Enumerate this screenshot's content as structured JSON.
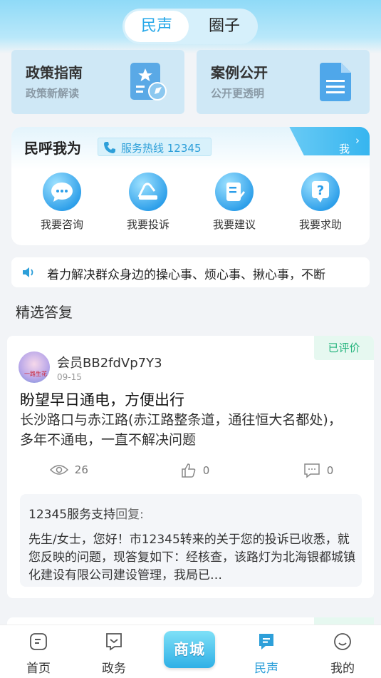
{
  "header": {
    "tabs": [
      {
        "label": "民声",
        "active": true
      },
      {
        "label": "圈子",
        "active": false
      }
    ]
  },
  "policy_cards": [
    {
      "title": "政策指南",
      "subtitle": "政策新解读",
      "icon": "policy-doc-icon"
    },
    {
      "title": "案例公开",
      "subtitle": "公开更透明",
      "icon": "document-icon"
    }
  ],
  "voice_panel": {
    "title": "民呼我为",
    "hotline": "服务热线 12345",
    "my_submissions": "我提交的",
    "actions": [
      {
        "label": "我要咨询",
        "icon": "chat-bubble-icon"
      },
      {
        "label": "我要投诉",
        "icon": "complaint-icon"
      },
      {
        "label": "我要建议",
        "icon": "suggestion-icon"
      },
      {
        "label": "我要求助",
        "icon": "help-question-icon"
      }
    ]
  },
  "notice": {
    "text": "着力解决群众身边的操心事、烦心事、揪心事，不断"
  },
  "section_title": "精选答复",
  "featured_answer": {
    "status_badge": "已评价",
    "user_name": "会员BB2fdVp7Y3",
    "date": "09-15",
    "title": "盼望早日通电，方便出行",
    "body": "长沙路口与赤江路(赤江路整条道，通往恒大名都处)，多年不通电，一直不解决问题",
    "views": "26",
    "likes": "0",
    "comments": "0",
    "reply_from": "12345服务支持",
    "reply_suffix": "回复:",
    "reply_text": "先生/女士，您好！市12345转来的关于您的投诉已收悉，就您反映的问题，现答复如下：经核查，该路灯为北海银都城镇化建设有限公司建设管理，我局已…"
  },
  "tabbar": {
    "items": [
      {
        "label": "首页",
        "icon": "home-icon",
        "active": false
      },
      {
        "label": "政务",
        "icon": "government-icon",
        "active": false
      },
      {
        "label": "商城",
        "icon": "mall-icon",
        "active": false
      },
      {
        "label": "民声",
        "icon": "voice-icon",
        "active": true
      },
      {
        "label": "我的",
        "icon": "profile-icon",
        "active": false
      }
    ]
  }
}
